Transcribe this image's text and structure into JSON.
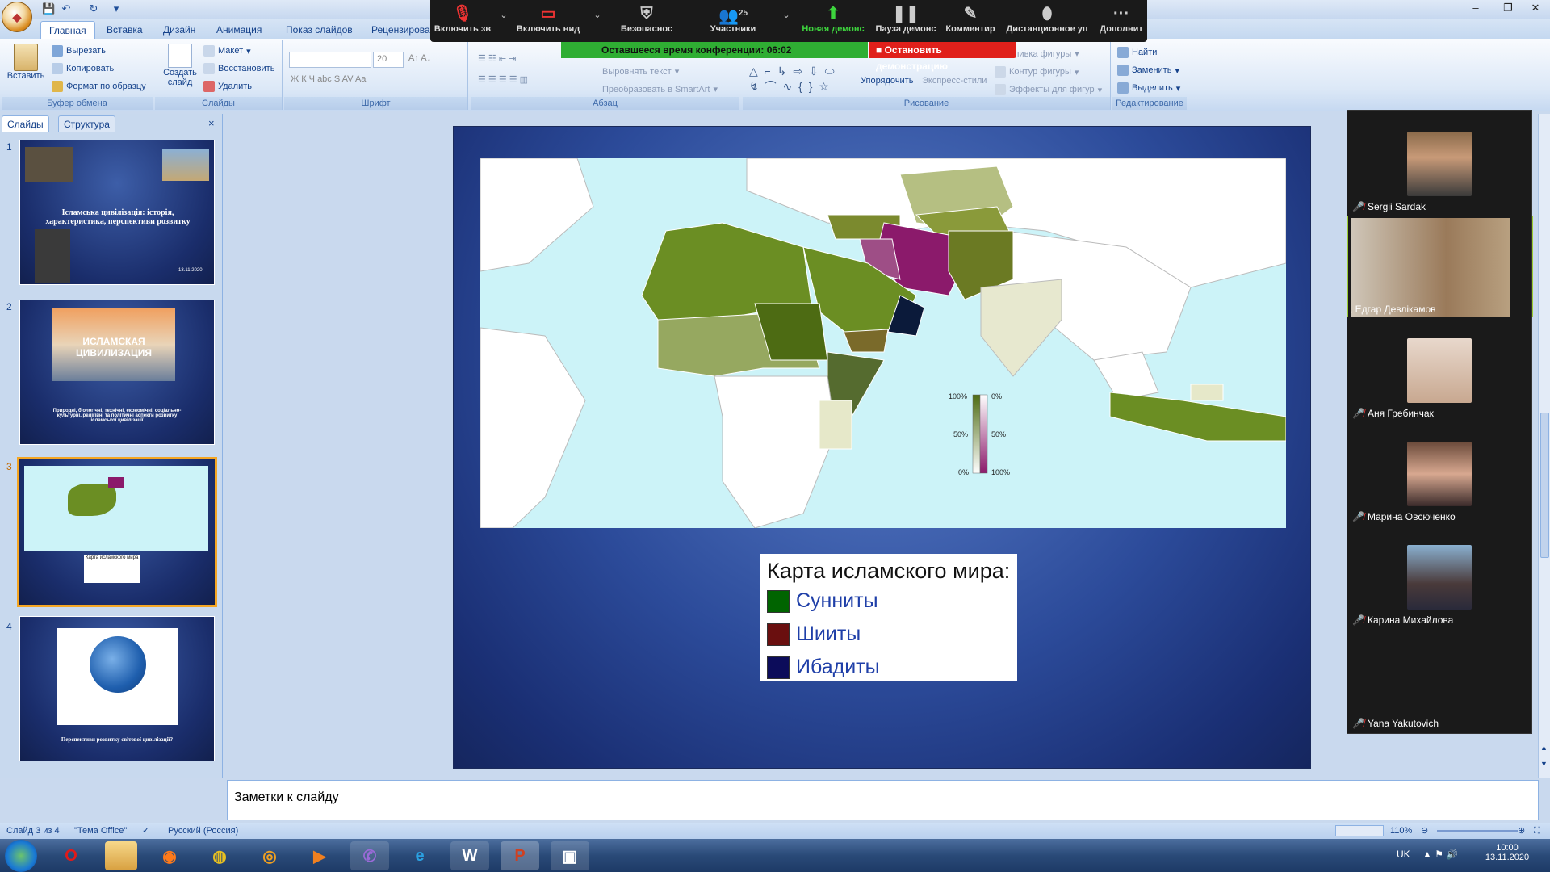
{
  "qat": {
    "save": "💾",
    "undo": "↶",
    "redo": "↻",
    "more": "▾"
  },
  "tabs": [
    "Главная",
    "Вставка",
    "Дизайн",
    "Анимация",
    "Показ слайдов",
    "Рецензирова"
  ],
  "ribbon": {
    "clipboard": {
      "label": "Буфер обмена",
      "paste": "Вставить",
      "cut": "Вырезать",
      "copy": "Копировать",
      "format": "Формат по образцу"
    },
    "slides": {
      "label": "Слайды",
      "new": "Создать слайд",
      "layout": "Макет",
      "restore": "Восстановить",
      "delete": "Удалить"
    },
    "font": {
      "label": "Шрифт",
      "size": "20"
    },
    "paragraph": {
      "label": "Абзац",
      "align_text": "Выровнять текст",
      "smartart": "Преобразовать в SmartArt"
    },
    "drawing": {
      "label": "Рисование",
      "arrange": "Упорядочить",
      "quick_styles": "Экспресс-стили",
      "shape_fill": "ливка фигуры",
      "shape_outline": "Контур фигуры",
      "shape_effects": "Эффекты для фигур"
    },
    "editing": {
      "label": "Редактирование",
      "find": "Найти",
      "replace": "Заменить",
      "select": "Выделить"
    }
  },
  "zoom": {
    "mute": "Включить зв",
    "video": "Включить вид",
    "security": "Безопаснос",
    "participants": "Участники",
    "participants_count": "25",
    "new_share": "Новая демонс",
    "pause_share": "Пауза демонс",
    "annotate": "Комментир",
    "remote": "Дистанционное уп",
    "more": "Дополнит",
    "time_left": "Оставшееся время конференции: 06:02",
    "stop_share": "Остановить демонстрацию"
  },
  "leftpane": {
    "tab_slides": "Слайды",
    "tab_outline": "Структура",
    "close": "×",
    "thumbs": [
      {
        "num": "1",
        "title": "Ісламська цивілізація: історія, характеристика, перспективи розвитку",
        "date": "13.11.2020"
      },
      {
        "num": "2",
        "title": "ИСЛАМСКАЯ ЦИВИЛИЗАЦИЯ",
        "text": "Природні, біологічні, технічні, економічні, соціально-культурні, релігійні та політичні аспекти розвитку ісламської цивілізації"
      },
      {
        "num": "3",
        "title": "Карта исламского мира"
      },
      {
        "num": "4",
        "text": "Перспективи розвитку світової цивілізації?"
      }
    ]
  },
  "slide": {
    "legend_title": "Карта исламского мира:",
    "legend": [
      {
        "label": "Сунниты",
        "color": "#006400"
      },
      {
        "label": "Шииты",
        "color": "#6a0f0f"
      },
      {
        "label": "Ибадиты",
        "color": "#0c0c5a"
      }
    ],
    "scale_left": [
      "100%",
      "50%",
      "0%"
    ],
    "scale_right": [
      "0%",
      "50%",
      "100%"
    ]
  },
  "notes_placeholder": "Заметки к слайду",
  "status": {
    "slide": "Слайд 3 из 4",
    "theme": "\"Тема Office\"",
    "lang": "Русский (Россия)",
    "zoom": "110%"
  },
  "participants": [
    {
      "name": "Sergii Sardak"
    },
    {
      "name": ", Едгар Девлікамов"
    },
    {
      "name": "Аня Гребинчак"
    },
    {
      "name": "Марина Овсюченко"
    },
    {
      "name": "Карина Михайлова"
    },
    {
      "name": "Yana Yakutovich"
    }
  ],
  "tray": {
    "lang": "UK",
    "time": "10:00",
    "date": "13.11.2020"
  },
  "colors": {
    "ribbon_text": "#15428b",
    "zoom_green": "#2fae33",
    "zoom_red": "#e0201b",
    "sunni": "#6b8e23",
    "shia": "#8b1a6b"
  }
}
